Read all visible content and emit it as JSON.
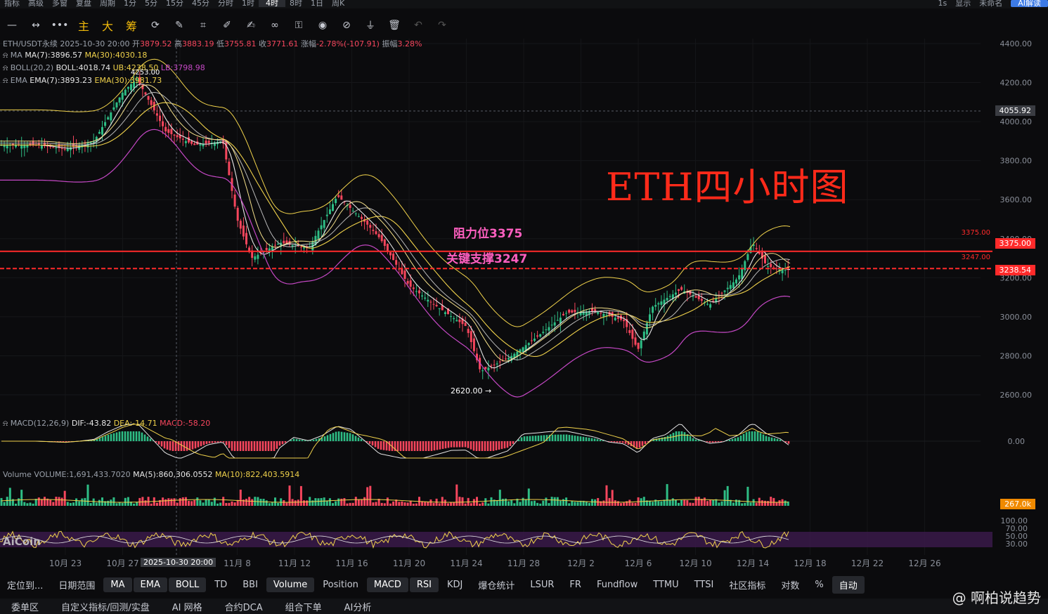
{
  "top_bar": {
    "items": [
      "指标",
      "高级",
      "多窗",
      "复盘",
      "周期",
      "1分",
      "5分",
      "15分",
      "45分",
      "分时",
      "1时",
      "4时",
      "8时",
      "1日",
      "周K"
    ],
    "active": "4时",
    "right_items": [
      "1s",
      "显示",
      "未命名"
    ],
    "ai_button": "AI解读"
  },
  "toolbar": {
    "tools": [
      "主",
      "大",
      "筹"
    ]
  },
  "legend": {
    "symbol": "ETH/USDT永续",
    "time": "2025-10-30 20:00",
    "open_label": "开",
    "open": "3879.52",
    "high_label": "高",
    "high": "3883.19",
    "low_label": "低",
    "low": "3755.81",
    "close_label": "收",
    "close": "3771.61",
    "change_label": "涨幅",
    "change": "-2.78%(-107.91)",
    "amp_label": "振幅",
    "amp": "3.28%",
    "ma_name": "MA",
    "ma7": "MA(7):3896.57",
    "ma30": "MA(30):4030.18",
    "boll_name": "BOLL(20,2)",
    "boll": "BOLL:4018.74",
    "boll_ub": "UB:4238.50",
    "boll_lb": "LB:3798.98",
    "ema_name": "EMA",
    "ema7": "EMA(7):3893.23",
    "ema30": "EMA(30):3981.73",
    "macd_name": "MACD(12,26,9)",
    "macd_dif": "DIF:-43.82",
    "macd_dea": "DEA:-14.71",
    "macd_val": "MACD:-58.20",
    "vol_name": "Volume",
    "vol_val": "VOLUME:1,691,433.7020",
    "vol_ma5": "MA(5):860,306.0552",
    "vol_ma10": "MA(10):822,403.5914"
  },
  "annotations": {
    "title": "ETH四小时图",
    "resistance_label": "阻力位3375",
    "support_label": "关键支撑3247",
    "resistance_tag": "3375.00",
    "support_tag": "3238.54",
    "resistance_small": "3375.00",
    "support_small": "3247.00",
    "crosshair_price": "4055.92",
    "low_marker": "2620.00 →",
    "high_marker": "4253.00",
    "vol_tag": "267.0k",
    "crosshair_time": "2025-10-30 20:00"
  },
  "colors": {
    "up": "#2ebd85",
    "down": "#f6465d",
    "level_line": "#ff2a2a",
    "ma_white": "#e6e6e6",
    "ma_yellow": "#f0d24b",
    "boll_pink": "#c548c5",
    "title_red": "#ff2a1a"
  },
  "chart_data": {
    "type": "candlestick",
    "title": "",
    "xlabel": "",
    "ylabel": "",
    "price_ylim": [
      2500,
      4450
    ],
    "price_ticks": [
      "4400.00",
      "4200.00",
      "4000.00",
      "3800.00",
      "3600.00",
      "3400.00",
      "3200.00",
      "3000.00",
      "2800.00",
      "2600.00"
    ],
    "x_ticks": [
      "10月 23",
      "10月 27",
      "11月 4",
      "11月 8",
      "11月 12",
      "11月 16",
      "11月 20",
      "11月 24",
      "11月 28",
      "12月 2",
      "12月 6",
      "12月 10",
      "12月 14",
      "12月 18",
      "12月 22",
      "12月 26"
    ],
    "close_path": [
      [
        "10-21",
        3880
      ],
      [
        "10-23",
        3860
      ],
      [
        "10-25",
        3900
      ],
      [
        "10-27",
        4150
      ],
      [
        "10-28",
        4220
      ],
      [
        "10-30",
        3950
      ],
      [
        "11-01",
        3880
      ],
      [
        "11-03",
        3900
      ],
      [
        "11-04",
        3500
      ],
      [
        "11-05",
        3300
      ],
      [
        "11-07",
        3380
      ],
      [
        "11-09",
        3350
      ],
      [
        "11-11",
        3620
      ],
      [
        "11-13",
        3480
      ],
      [
        "11-14",
        3400
      ],
      [
        "11-16",
        3160
      ],
      [
        "11-18",
        3050
      ],
      [
        "11-20",
        2950
      ],
      [
        "11-21",
        2720
      ],
      [
        "11-23",
        2790
      ],
      [
        "11-25",
        2900
      ],
      [
        "11-27",
        3020
      ],
      [
        "11-29",
        3030
      ],
      [
        "12-01",
        2980
      ],
      [
        "12-02",
        2830
      ],
      [
        "12-03",
        3050
      ],
      [
        "12-05",
        3140
      ],
      [
        "12-07",
        3060
      ],
      [
        "12-09",
        3200
      ],
      [
        "12-10",
        3380
      ],
      [
        "12-11",
        3260
      ],
      [
        "12-12",
        3240
      ]
    ],
    "levels": [
      {
        "name": "阻力位",
        "value": 3375
      },
      {
        "name": "关键支撑",
        "value": 3247
      }
    ],
    "macd_tick": "0.00",
    "rsi_ticks": [
      "100.00",
      "70.00",
      "50.00",
      "30.00"
    ]
  },
  "bottom_tabs": [
    "定位到...",
    "日期范围",
    "MA",
    "EMA",
    "BOLL",
    "TD",
    "BBI",
    "Volume",
    "Position",
    "MACD",
    "RSI",
    "KDJ",
    "爆仓统计",
    "LSUR",
    "FR",
    "Fundflow",
    "TTMU",
    "TTSI",
    "社区指标",
    "对数",
    "%",
    "自动"
  ],
  "bottom_tabs_active": [
    "MA",
    "EMA",
    "BOLL",
    "Volume",
    "MACD",
    "RSI",
    "自动"
  ],
  "bottom_row2": [
    "委单区",
    "自定义指标/回测/实盘",
    "AI 网格",
    "合约DCA",
    "组合下单",
    "AI分析"
  ],
  "watermark": "@ 啊柏说趋势",
  "brand": "AiCoin"
}
